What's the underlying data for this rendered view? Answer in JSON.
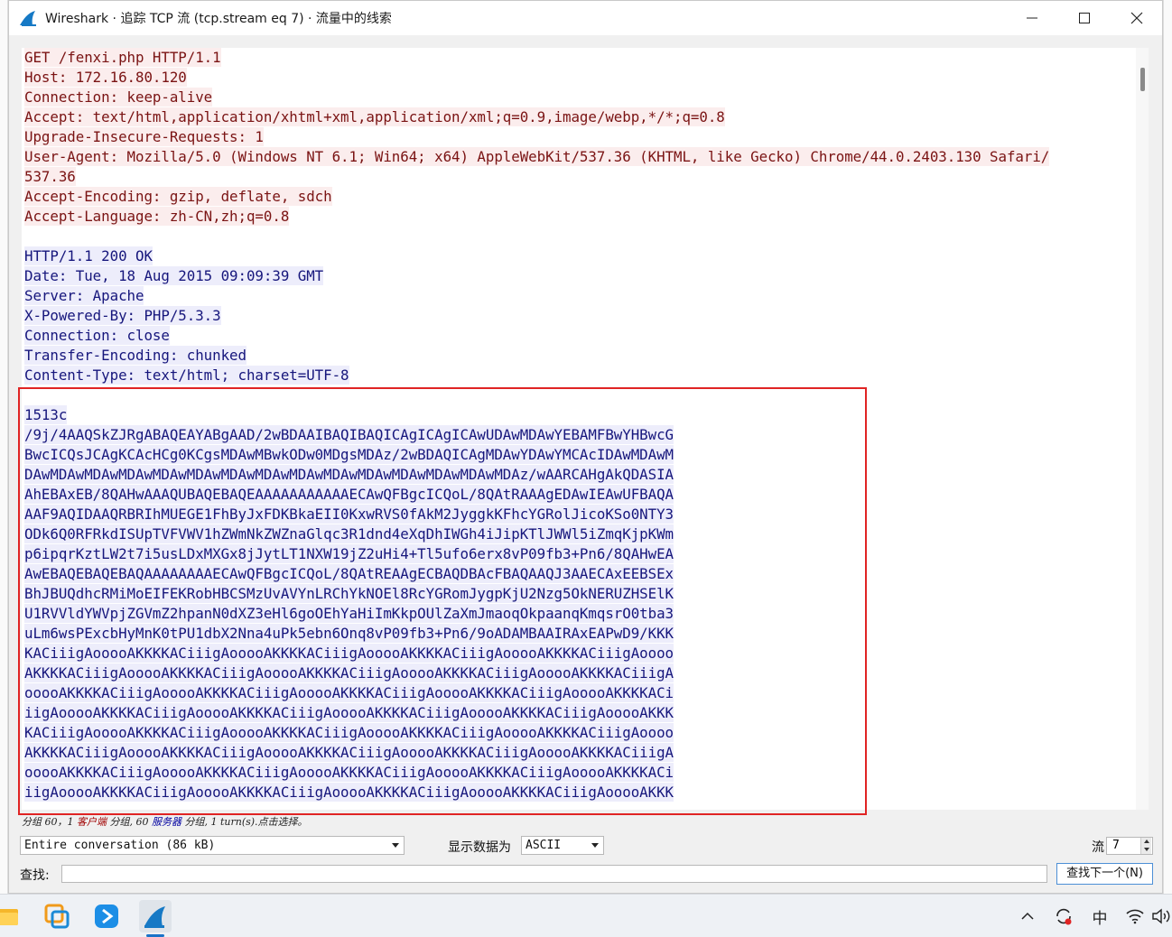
{
  "window": {
    "title": "Wireshark · 追踪 TCP 流 (tcp.stream eq 7) · 流量中的线索"
  },
  "stream_lines": [
    {
      "text": "GET /fenxi.php HTTP/1.1",
      "dir": "client"
    },
    {
      "text": "Host: 172.16.80.120",
      "dir": "client"
    },
    {
      "text": "Connection: keep-alive",
      "dir": "client"
    },
    {
      "text": "Accept: text/html,application/xhtml+xml,application/xml;q=0.9,image/webp,*/*;q=0.8",
      "dir": "client"
    },
    {
      "text": "Upgrade-Insecure-Requests: 1",
      "dir": "client"
    },
    {
      "text": "User-Agent: Mozilla/5.0 (Windows NT 6.1; Win64; x64) AppleWebKit/537.36 (KHTML, like Gecko) Chrome/44.0.2403.130 Safari/",
      "dir": "client"
    },
    {
      "text": "537.36",
      "dir": "client"
    },
    {
      "text": "Accept-Encoding: gzip, deflate, sdch",
      "dir": "client"
    },
    {
      "text": "Accept-Language: zh-CN,zh;q=0.8",
      "dir": "client"
    },
    {
      "text": "",
      "dir": "none"
    },
    {
      "text": "HTTP/1.1 200 OK",
      "dir": "server"
    },
    {
      "text": "Date: Tue, 18 Aug 2015 09:09:39 GMT",
      "dir": "server"
    },
    {
      "text": "Server: Apache",
      "dir": "server"
    },
    {
      "text": "X-Powered-By: PHP/5.3.3",
      "dir": "server"
    },
    {
      "text": "Connection: close",
      "dir": "server"
    },
    {
      "text": "Transfer-Encoding: chunked",
      "dir": "server"
    },
    {
      "text": "Content-Type: text/html; charset=UTF-8",
      "dir": "server"
    },
    {
      "text": "",
      "dir": "none"
    },
    {
      "text": "1513c",
      "dir": "server"
    },
    {
      "text": "/9j/4AAQSkZJRgABAQEAYABgAAD/2wBDAAIBAQIBAQICAgICAgICAwUDAwMDAwYEBAMFBwYHBwcG",
      "dir": "server"
    },
    {
      "text": "BwcICQsJCAgKCAcHCg0KCgsMDAwMBwkODw0MDgsMDAz/2wBDAQICAgMDAwYDAwYMCAcIDAwMDAwM",
      "dir": "server"
    },
    {
      "text": "DAwMDAwMDAwMDAwMDAwMDAwMDAwMDAwMDAwMDAwMDAwMDAwMDAwMDAwMDAz/wAARCAHgAkQDASIA",
      "dir": "server"
    },
    {
      "text": "AhEBAxEB/8QAHwAAAQUBAQEBAQEAAAAAAAAAAAECAwQFBgcICQoL/8QAtRAAAgEDAwIEAwUFBAQA",
      "dir": "server"
    },
    {
      "text": "AAF9AQIDAAQRBRIhMUEGE1FhByJxFDKBkaEII0KxwRVS0fAkM2JyggkKFhcYGRolJicoKSo0NTY3",
      "dir": "server"
    },
    {
      "text": "ODk6Q0RFRkdISUpTVFVWV1hZWmNkZWZnaGlqc3R1dnd4eXqDhIWGh4iJipKTlJWWl5iZmqKjpKWm",
      "dir": "server"
    },
    {
      "text": "p6ipqrKztLW2t7i5usLDxMXGx8jJytLT1NXW19jZ2uHi4+Tl5ufo6erx8vP09fb3+Pn6/8QAHwEA",
      "dir": "server"
    },
    {
      "text": "AwEBAQEBAQEBAQAAAAAAAAECAwQFBgcICQoL/8QAtREAAgECBAQDBAcFBAQAAQJ3AAECAxEEBSEx",
      "dir": "server"
    },
    {
      "text": "BhJBUQdhcRMiMoEIFEKRobHBCSMzUvAVYnLRChYkNOEl8RcYGRomJygpKjU2Nzg5OkNERUZHSElK",
      "dir": "server"
    },
    {
      "text": "U1RVVldYWVpjZGVmZ2hpanN0dXZ3eHl6goOEhYaHiImKkpOUlZaXmJmaoqOkpaanqKmqsrO0tba3",
      "dir": "server"
    },
    {
      "text": "uLm6wsPExcbHyMnK0tPU1dbX2Nna4uPk5ebn6Onq8vP09fb3+Pn6/9oADAMBAAIRAxEAPwD9/KKK",
      "dir": "server"
    },
    {
      "text": "KACiiigAooooAKKKKACiiigAooooAKKKKACiiigAooooAKKKKACiiigAooooAKKKKACiiigAoooo",
      "dir": "server"
    },
    {
      "text": "AKKKKACiiigAooooAKKKKACiiigAooooAKKKKACiiigAooooAKKKKACiiigAooooAKKKKACiiigA",
      "dir": "server"
    },
    {
      "text": "ooooAKKKKACiiigAooooAKKKKACiiigAooooAKKKKACiiigAooooAKKKKACiiigAooooAKKKKACi",
      "dir": "server"
    },
    {
      "text": "iigAooooAKKKKACiiigAooooAKKKKACiiigAooooAKKKKACiiigAooooAKKKKACiiigAooooAKKK",
      "dir": "server"
    },
    {
      "text": "KACiiigAooooAKKKKACiiigAooooAKKKKACiiigAooooAKKKKACiiigAooooAKKKKACiiigAoooo",
      "dir": "server"
    },
    {
      "text": "AKKKKACiiigAooooAKKKKACiiigAooooAKKKKACiiigAooooAKKKKACiiigAooooAKKKKACiiigA",
      "dir": "server"
    },
    {
      "text": "ooooAKKKKACiiigAooooAKKKKACiiigAooooAKKKKACiiigAooooAKKKKACiiigAooooAKKKKACi",
      "dir": "server"
    },
    {
      "text": "iigAooooAKKKKACiiigAooooAKKKKACiiigAooooAKKKKACiiigAooooAKKKKACiiigAooooAKKK",
      "dir": "server"
    }
  ],
  "status": {
    "prefix": "分组 60，1 ",
    "client_label": "客户端",
    "mid": " 分组, 60 ",
    "server_label": "服务器",
    "suffix": " 分组, 1 turn(s).点击选择。"
  },
  "controls": {
    "conversation_select": "Entire conversation (86 kB)",
    "show_as_label": "显示数据为",
    "show_as_value": "ASCII",
    "stream_label": "流",
    "stream_value": "7",
    "find_label": "查找:",
    "find_placeholder": "",
    "find_next_button": "查找下一个(N)"
  },
  "taskbar": {
    "ime_indicator": "中"
  },
  "colors": {
    "client_bg": "#fbeded",
    "client_fg": "#7a1313",
    "server_bg": "#ededfb",
    "server_fg": "#16167c",
    "highlight": "#e02424"
  }
}
